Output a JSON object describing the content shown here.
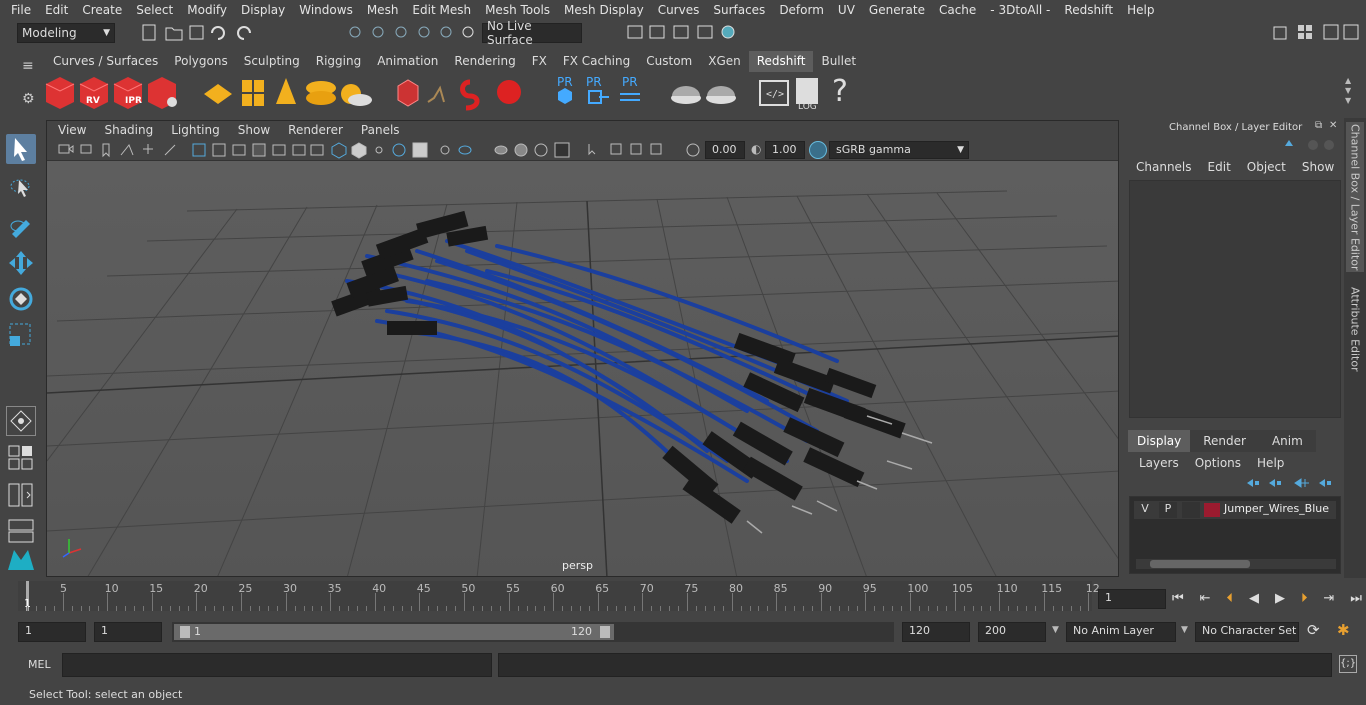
{
  "menubar": {
    "items": [
      "File",
      "Edit",
      "Create",
      "Select",
      "Modify",
      "Display",
      "Windows",
      "Mesh",
      "Edit Mesh",
      "Mesh Tools",
      "Mesh Display",
      "Curves",
      "Surfaces",
      "Deform",
      "UV",
      "Generate",
      "Cache",
      "- 3DtoAll -",
      "Redshift",
      "Help"
    ]
  },
  "status": {
    "mode": "Modeling",
    "live_surface": "No Live Surface"
  },
  "shelf_tabs": [
    "Curves / Surfaces",
    "Polygons",
    "Sculpting",
    "Rigging",
    "Animation",
    "Rendering",
    "FX",
    "FX Caching",
    "Custom",
    "XGen",
    "Redshift",
    "Bullet"
  ],
  "shelf_active": "Redshift",
  "shelf_icons": {
    "rv": "RV",
    "ipr": "IPR",
    "pr1": "PR",
    "pr2": "PR",
    "pr3": "PR",
    "log": "LOG",
    "help": "?"
  },
  "viewport": {
    "menu": [
      "View",
      "Shading",
      "Lighting",
      "Show",
      "Renderer",
      "Panels"
    ],
    "exposure": "0.00",
    "gamma": "1.00",
    "color_space": "sGRB gamma",
    "camera_label": "persp"
  },
  "channel_box": {
    "title": "Channel Box / Layer Editor",
    "menu": [
      "Channels",
      "Edit",
      "Object",
      "Show"
    ]
  },
  "layer_editor": {
    "tabs": [
      "Display",
      "Render",
      "Anim"
    ],
    "active_tab": "Display",
    "menu": [
      "Layers",
      "Options",
      "Help"
    ],
    "layers": [
      {
        "visible": "V",
        "playback": "P",
        "name": "Jumper_Wires_Blue",
        "color": "#9b1b2f"
      }
    ]
  },
  "side_tabs": [
    "Channel Box / Layer Editor",
    "Attribute Editor"
  ],
  "timeline": {
    "ticks": [
      "5",
      "10",
      "15",
      "20",
      "25",
      "30",
      "35",
      "40",
      "45",
      "50",
      "55",
      "60",
      "65",
      "70",
      "75",
      "80",
      "85",
      "90",
      "95",
      "100",
      "105",
      "110",
      "115",
      "12"
    ],
    "start_marker": "1",
    "current_frame": "1"
  },
  "range": {
    "start": "1",
    "playback_start": "1",
    "slider_start": "1",
    "slider_end": "120",
    "playback_end": "120",
    "end": "200",
    "anim_layer": "No Anim Layer",
    "character_set": "No Character Set"
  },
  "command": {
    "label": "MEL"
  },
  "help_line": "Select Tool: select an object"
}
